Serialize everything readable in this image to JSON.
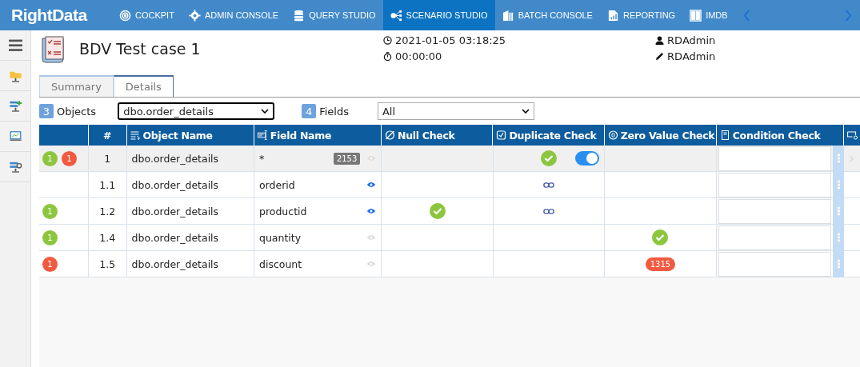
{
  "nav": {
    "logo": "RightData",
    "items": [
      {
        "label": "COCKPIT",
        "selected": false
      },
      {
        "label": "ADMIN CONSOLE",
        "selected": false
      },
      {
        "label": "QUERY STUDIO",
        "selected": false
      },
      {
        "label": "SCENARIO STUDIO",
        "selected": true
      },
      {
        "label": "BATCH CONSOLE",
        "selected": false
      },
      {
        "label": "REPORTING",
        "selected": false
      },
      {
        "label": "IMDB",
        "selected": false
      }
    ]
  },
  "header": {
    "title": "BDV Test case 1",
    "timestamp": "2021-01-05 03:18:25",
    "duration": "00:00:00",
    "owner": "RDAdmin",
    "editor": "RDAdmin"
  },
  "tabs": [
    {
      "label": "Summary",
      "selected": false
    },
    {
      "label": "Details",
      "selected": true
    }
  ],
  "filters": {
    "objects_count": "3",
    "objects_label": "Objects",
    "objects_value": "dbo.order_details",
    "fields_count": "4",
    "fields_label": "Fields",
    "fields_value": "All"
  },
  "table": {
    "columns": [
      "#",
      "Object Name",
      "Field Name",
      "Null Check",
      "Duplicate Check",
      "Zero Value Check",
      "Condition Check"
    ],
    "rows": [
      {
        "selected": true,
        "badges": [
          {
            "text": "1",
            "color": "#8cc63f"
          },
          {
            "text": "1",
            "color": "#f15a40"
          }
        ],
        "number": "1",
        "object": "dbo.order_details",
        "field": "*",
        "count": "2153",
        "eye_active": false,
        "null_check": [],
        "duplicate_check": [
          {
            "kind": "check"
          },
          {
            "kind": "toggle",
            "on": true
          }
        ],
        "zero_check": [],
        "expand": true
      },
      {
        "selected": false,
        "badges": [],
        "number": "1.1",
        "object": "dbo.order_details",
        "field": "orderid",
        "eye_active": true,
        "null_check": [],
        "duplicate_check": [
          {
            "kind": "link"
          }
        ],
        "zero_check": [],
        "expand": false
      },
      {
        "selected": false,
        "badges": [
          {
            "text": "1",
            "color": "#8cc63f"
          }
        ],
        "number": "1.2",
        "object": "dbo.order_details",
        "field": "productid",
        "eye_active": true,
        "null_check": [
          {
            "kind": "check"
          }
        ],
        "duplicate_check": [
          {
            "kind": "link"
          }
        ],
        "zero_check": [],
        "expand": false
      },
      {
        "selected": false,
        "badges": [
          {
            "text": "1",
            "color": "#8cc63f"
          }
        ],
        "number": "1.4",
        "object": "dbo.order_details",
        "field": "quantity",
        "eye_active": false,
        "null_check": [],
        "duplicate_check": [],
        "zero_check": [
          {
            "kind": "check"
          }
        ],
        "expand": false
      },
      {
        "selected": false,
        "badges": [
          {
            "text": "1",
            "color": "#f15a40"
          }
        ],
        "number": "1.5",
        "object": "dbo.order_details",
        "field": "discount",
        "eye_active": false,
        "null_check": [],
        "duplicate_check": [],
        "zero_check": [
          {
            "kind": "count",
            "text": "1315"
          }
        ],
        "expand": false
      }
    ]
  }
}
